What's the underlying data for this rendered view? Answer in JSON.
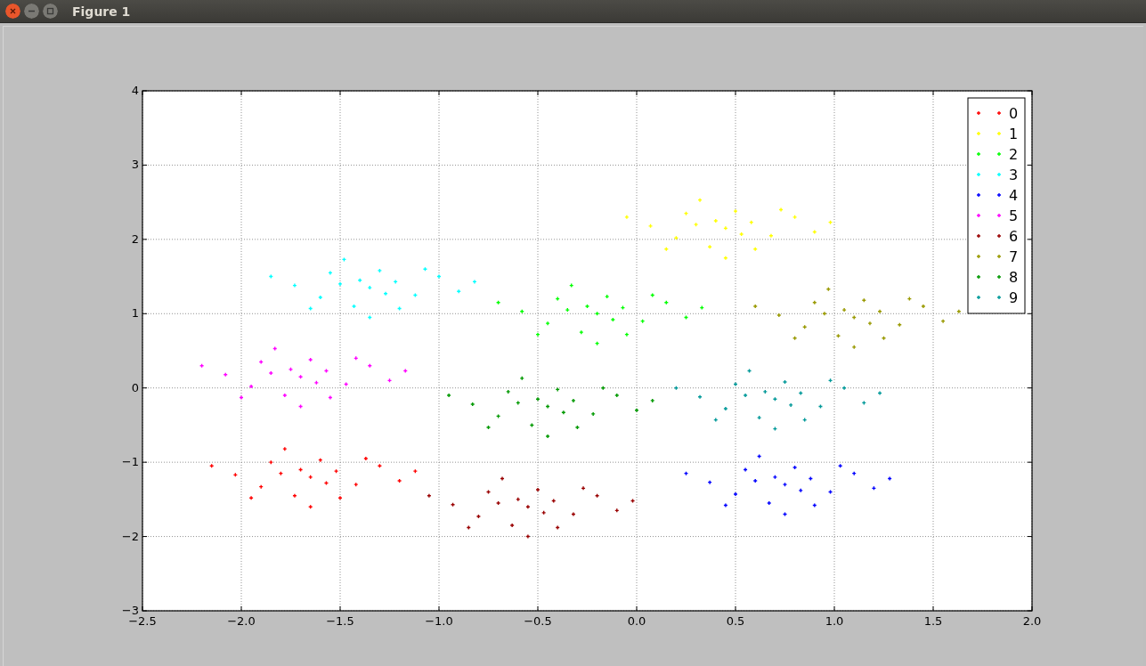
{
  "window": {
    "title": "Figure 1"
  },
  "chart_data": {
    "type": "scatter",
    "grid": true,
    "legend": true,
    "xlim": [
      -2.5,
      2.0
    ],
    "ylim": [
      -3,
      4
    ],
    "xticks": [
      {
        "value": -2.5,
        "label": "−2.5"
      },
      {
        "value": -2.0,
        "label": "−2.0"
      },
      {
        "value": -1.5,
        "label": "−1.5"
      },
      {
        "value": -1.0,
        "label": "−1.0"
      },
      {
        "value": -0.5,
        "label": "−0.5"
      },
      {
        "value": 0.0,
        "label": "0.0"
      },
      {
        "value": 0.5,
        "label": "0.5"
      },
      {
        "value": 1.0,
        "label": "1.0"
      },
      {
        "value": 1.5,
        "label": "1.5"
      },
      {
        "value": 2.0,
        "label": "2.0"
      }
    ],
    "yticks": [
      {
        "value": -3,
        "label": "−3"
      },
      {
        "value": -2,
        "label": "−2"
      },
      {
        "value": -1,
        "label": "−1"
      },
      {
        "value": 0,
        "label": "0"
      },
      {
        "value": 1,
        "label": "1"
      },
      {
        "value": 2,
        "label": "2"
      },
      {
        "value": 3,
        "label": "3"
      },
      {
        "value": 4,
        "label": "4"
      }
    ],
    "series": [
      {
        "name": "0",
        "color": "#ff0000",
        "x": [
          -1.65,
          -1.52,
          -1.8,
          -1.42,
          -1.9,
          -1.6,
          -1.73,
          -1.3,
          -2.03,
          -1.5,
          -1.85,
          -1.37,
          -1.7,
          -1.57,
          -1.95,
          -1.2,
          -1.65,
          -1.78,
          -1.12,
          -2.15
        ],
        "values": [
          -1.2,
          -1.12,
          -1.15,
          -1.3,
          -1.33,
          -0.97,
          -1.45,
          -1.05,
          -1.17,
          -1.48,
          -1.0,
          -0.95,
          -1.1,
          -1.28,
          -1.48,
          -1.25,
          -1.6,
          -0.82,
          -1.12,
          -1.05
        ]
      },
      {
        "name": "1",
        "color": "#ffff00",
        "x": [
          0.45,
          0.58,
          0.3,
          0.68,
          0.2,
          0.5,
          0.37,
          0.8,
          0.07,
          0.6,
          0.25,
          0.73,
          0.4,
          0.53,
          0.15,
          0.9,
          0.45,
          0.32,
          0.98,
          -0.05
        ],
        "values": [
          2.15,
          2.23,
          2.2,
          2.05,
          2.02,
          2.38,
          1.9,
          2.3,
          2.18,
          1.87,
          2.35,
          2.4,
          2.25,
          2.07,
          1.87,
          2.1,
          1.75,
          2.53,
          2.23,
          2.3
        ]
      },
      {
        "name": "2",
        "color": "#00ff00",
        "x": [
          -0.2,
          -0.07,
          -0.35,
          0.03,
          -0.45,
          -0.15,
          -0.28,
          0.15,
          -0.58,
          -0.05,
          -0.4,
          0.08,
          -0.25,
          -0.12,
          -0.5,
          0.25,
          -0.2,
          -0.33,
          0.33,
          -0.7
        ],
        "values": [
          1.0,
          1.08,
          1.05,
          0.9,
          0.87,
          1.23,
          0.75,
          1.15,
          1.03,
          0.72,
          1.2,
          1.25,
          1.1,
          0.92,
          0.72,
          0.95,
          0.6,
          1.38,
          1.08,
          1.15
        ]
      },
      {
        "name": "3",
        "color": "#00ffff",
        "x": [
          -1.35,
          -1.22,
          -1.5,
          -1.12,
          -1.6,
          -1.3,
          -1.43,
          -1.0,
          -1.73,
          -1.2,
          -1.55,
          -1.07,
          -1.4,
          -1.27,
          -1.65,
          -0.9,
          -1.35,
          -1.48,
          -0.82,
          -1.85
        ],
        "values": [
          1.35,
          1.43,
          1.4,
          1.25,
          1.22,
          1.58,
          1.1,
          1.5,
          1.38,
          1.07,
          1.55,
          1.6,
          1.45,
          1.27,
          1.07,
          1.3,
          0.95,
          1.73,
          1.43,
          1.5
        ]
      },
      {
        "name": "4",
        "color": "#0000ff",
        "x": [
          0.75,
          0.88,
          0.6,
          0.98,
          0.5,
          0.8,
          0.67,
          1.1,
          0.37,
          0.9,
          0.55,
          1.03,
          0.7,
          0.83,
          0.45,
          1.2,
          0.75,
          0.62,
          1.28,
          0.25
        ],
        "values": [
          -1.3,
          -1.22,
          -1.25,
          -1.4,
          -1.43,
          -1.07,
          -1.55,
          -1.15,
          -1.27,
          -1.58,
          -1.1,
          -1.05,
          -1.2,
          -1.38,
          -1.58,
          -1.35,
          -1.7,
          -0.92,
          -1.22,
          -1.15
        ]
      },
      {
        "name": "5",
        "color": "#ff00ff",
        "x": [
          -1.7,
          -1.57,
          -1.85,
          -1.47,
          -1.95,
          -1.65,
          -1.78,
          -1.35,
          -2.08,
          -1.55,
          -1.9,
          -1.42,
          -1.75,
          -1.62,
          -2.0,
          -1.25,
          -1.7,
          -1.83,
          -1.17,
          -2.2
        ],
        "values": [
          0.15,
          0.23,
          0.2,
          0.05,
          0.02,
          0.38,
          -0.1,
          0.3,
          0.18,
          -0.13,
          0.35,
          0.4,
          0.25,
          0.07,
          -0.13,
          0.1,
          -0.25,
          0.53,
          0.23,
          0.3
        ]
      },
      {
        "name": "6",
        "color": "#990000",
        "x": [
          -0.55,
          -0.42,
          -0.7,
          -0.32,
          -0.8,
          -0.5,
          -0.63,
          -0.2,
          -0.93,
          -0.4,
          -0.75,
          -0.27,
          -0.6,
          -0.47,
          -0.85,
          -0.1,
          -0.55,
          -0.68,
          -0.02,
          -1.05
        ],
        "values": [
          -1.6,
          -1.52,
          -1.55,
          -1.7,
          -1.73,
          -1.37,
          -1.85,
          -1.45,
          -1.57,
          -1.88,
          -1.4,
          -1.35,
          -1.5,
          -1.68,
          -1.88,
          -1.65,
          -2.0,
          -1.22,
          -1.52,
          -1.45
        ]
      },
      {
        "name": "7",
        "color": "#999900",
        "x": [
          1.1,
          1.23,
          0.95,
          1.33,
          0.85,
          1.15,
          1.02,
          1.45,
          0.72,
          1.25,
          0.9,
          1.38,
          1.05,
          1.18,
          0.8,
          1.55,
          1.1,
          0.97,
          1.63,
          0.6
        ],
        "values": [
          0.95,
          1.03,
          1.0,
          0.85,
          0.82,
          1.18,
          0.7,
          1.1,
          0.98,
          0.67,
          1.15,
          1.2,
          1.05,
          0.87,
          0.67,
          0.9,
          0.55,
          1.33,
          1.03,
          1.1
        ]
      },
      {
        "name": "8",
        "color": "#009900",
        "x": [
          -0.45,
          -0.32,
          -0.6,
          -0.22,
          -0.7,
          -0.4,
          -0.53,
          -0.1,
          -0.83,
          -0.3,
          -0.65,
          -0.17,
          -0.5,
          -0.37,
          -0.75,
          0.0,
          -0.45,
          -0.58,
          0.08,
          -0.95
        ],
        "values": [
          -0.25,
          -0.17,
          -0.2,
          -0.35,
          -0.38,
          -0.02,
          -0.5,
          -0.1,
          -0.22,
          -0.53,
          -0.05,
          0.0,
          -0.15,
          -0.33,
          -0.53,
          -0.3,
          -0.65,
          0.13,
          -0.17,
          -0.1
        ]
      },
      {
        "name": "9",
        "color": "#009999",
        "x": [
          0.7,
          0.83,
          0.55,
          0.93,
          0.45,
          0.75,
          0.62,
          1.05,
          0.32,
          0.85,
          0.5,
          0.98,
          0.65,
          0.78,
          0.4,
          1.15,
          0.7,
          0.57,
          1.23,
          0.2
        ],
        "values": [
          -0.15,
          -0.07,
          -0.1,
          -0.25,
          -0.28,
          0.08,
          -0.4,
          0.0,
          -0.12,
          -0.43,
          0.05,
          0.1,
          -0.05,
          -0.23,
          -0.43,
          -0.2,
          -0.55,
          0.23,
          -0.07,
          0.0
        ]
      }
    ]
  }
}
